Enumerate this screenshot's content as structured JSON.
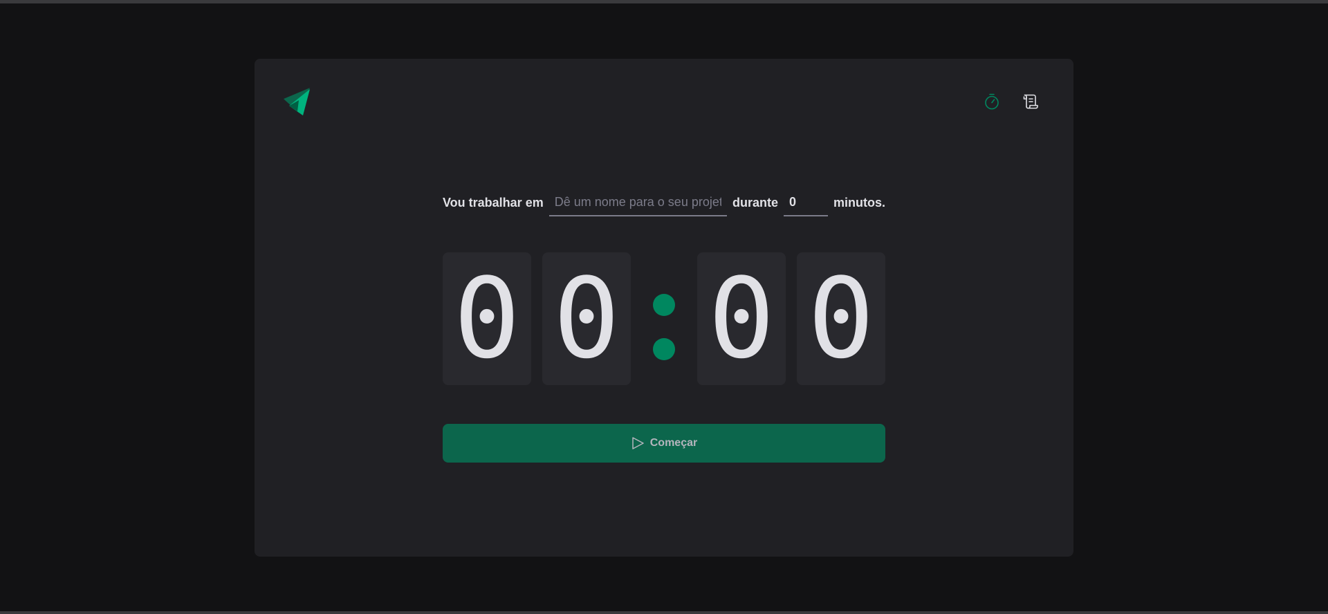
{
  "colors": {
    "background": "#121214",
    "card": "#202024",
    "digit_bg": "#29292e",
    "accent": "#00875f",
    "button_bg": "#0c664c",
    "text": "#e1e1e6",
    "placeholder": "#7c7c8a"
  },
  "header": {
    "logo_icon": "triangles-logo-icon",
    "nav": [
      {
        "icon": "timer-icon",
        "active": true
      },
      {
        "icon": "scroll-icon",
        "active": false
      }
    ]
  },
  "form": {
    "label_work": "Vou trabalhar em",
    "task_placeholder": "Dê um nome para o seu projeto",
    "task_value": "",
    "label_during": "durante",
    "minutes_value": "0",
    "label_minutes": "minutos."
  },
  "countdown": {
    "minutes_tens": "0",
    "minutes_units": "0",
    "seconds_tens": "0",
    "seconds_units": "0"
  },
  "start_button": {
    "icon": "play-icon",
    "label": "Começar"
  }
}
